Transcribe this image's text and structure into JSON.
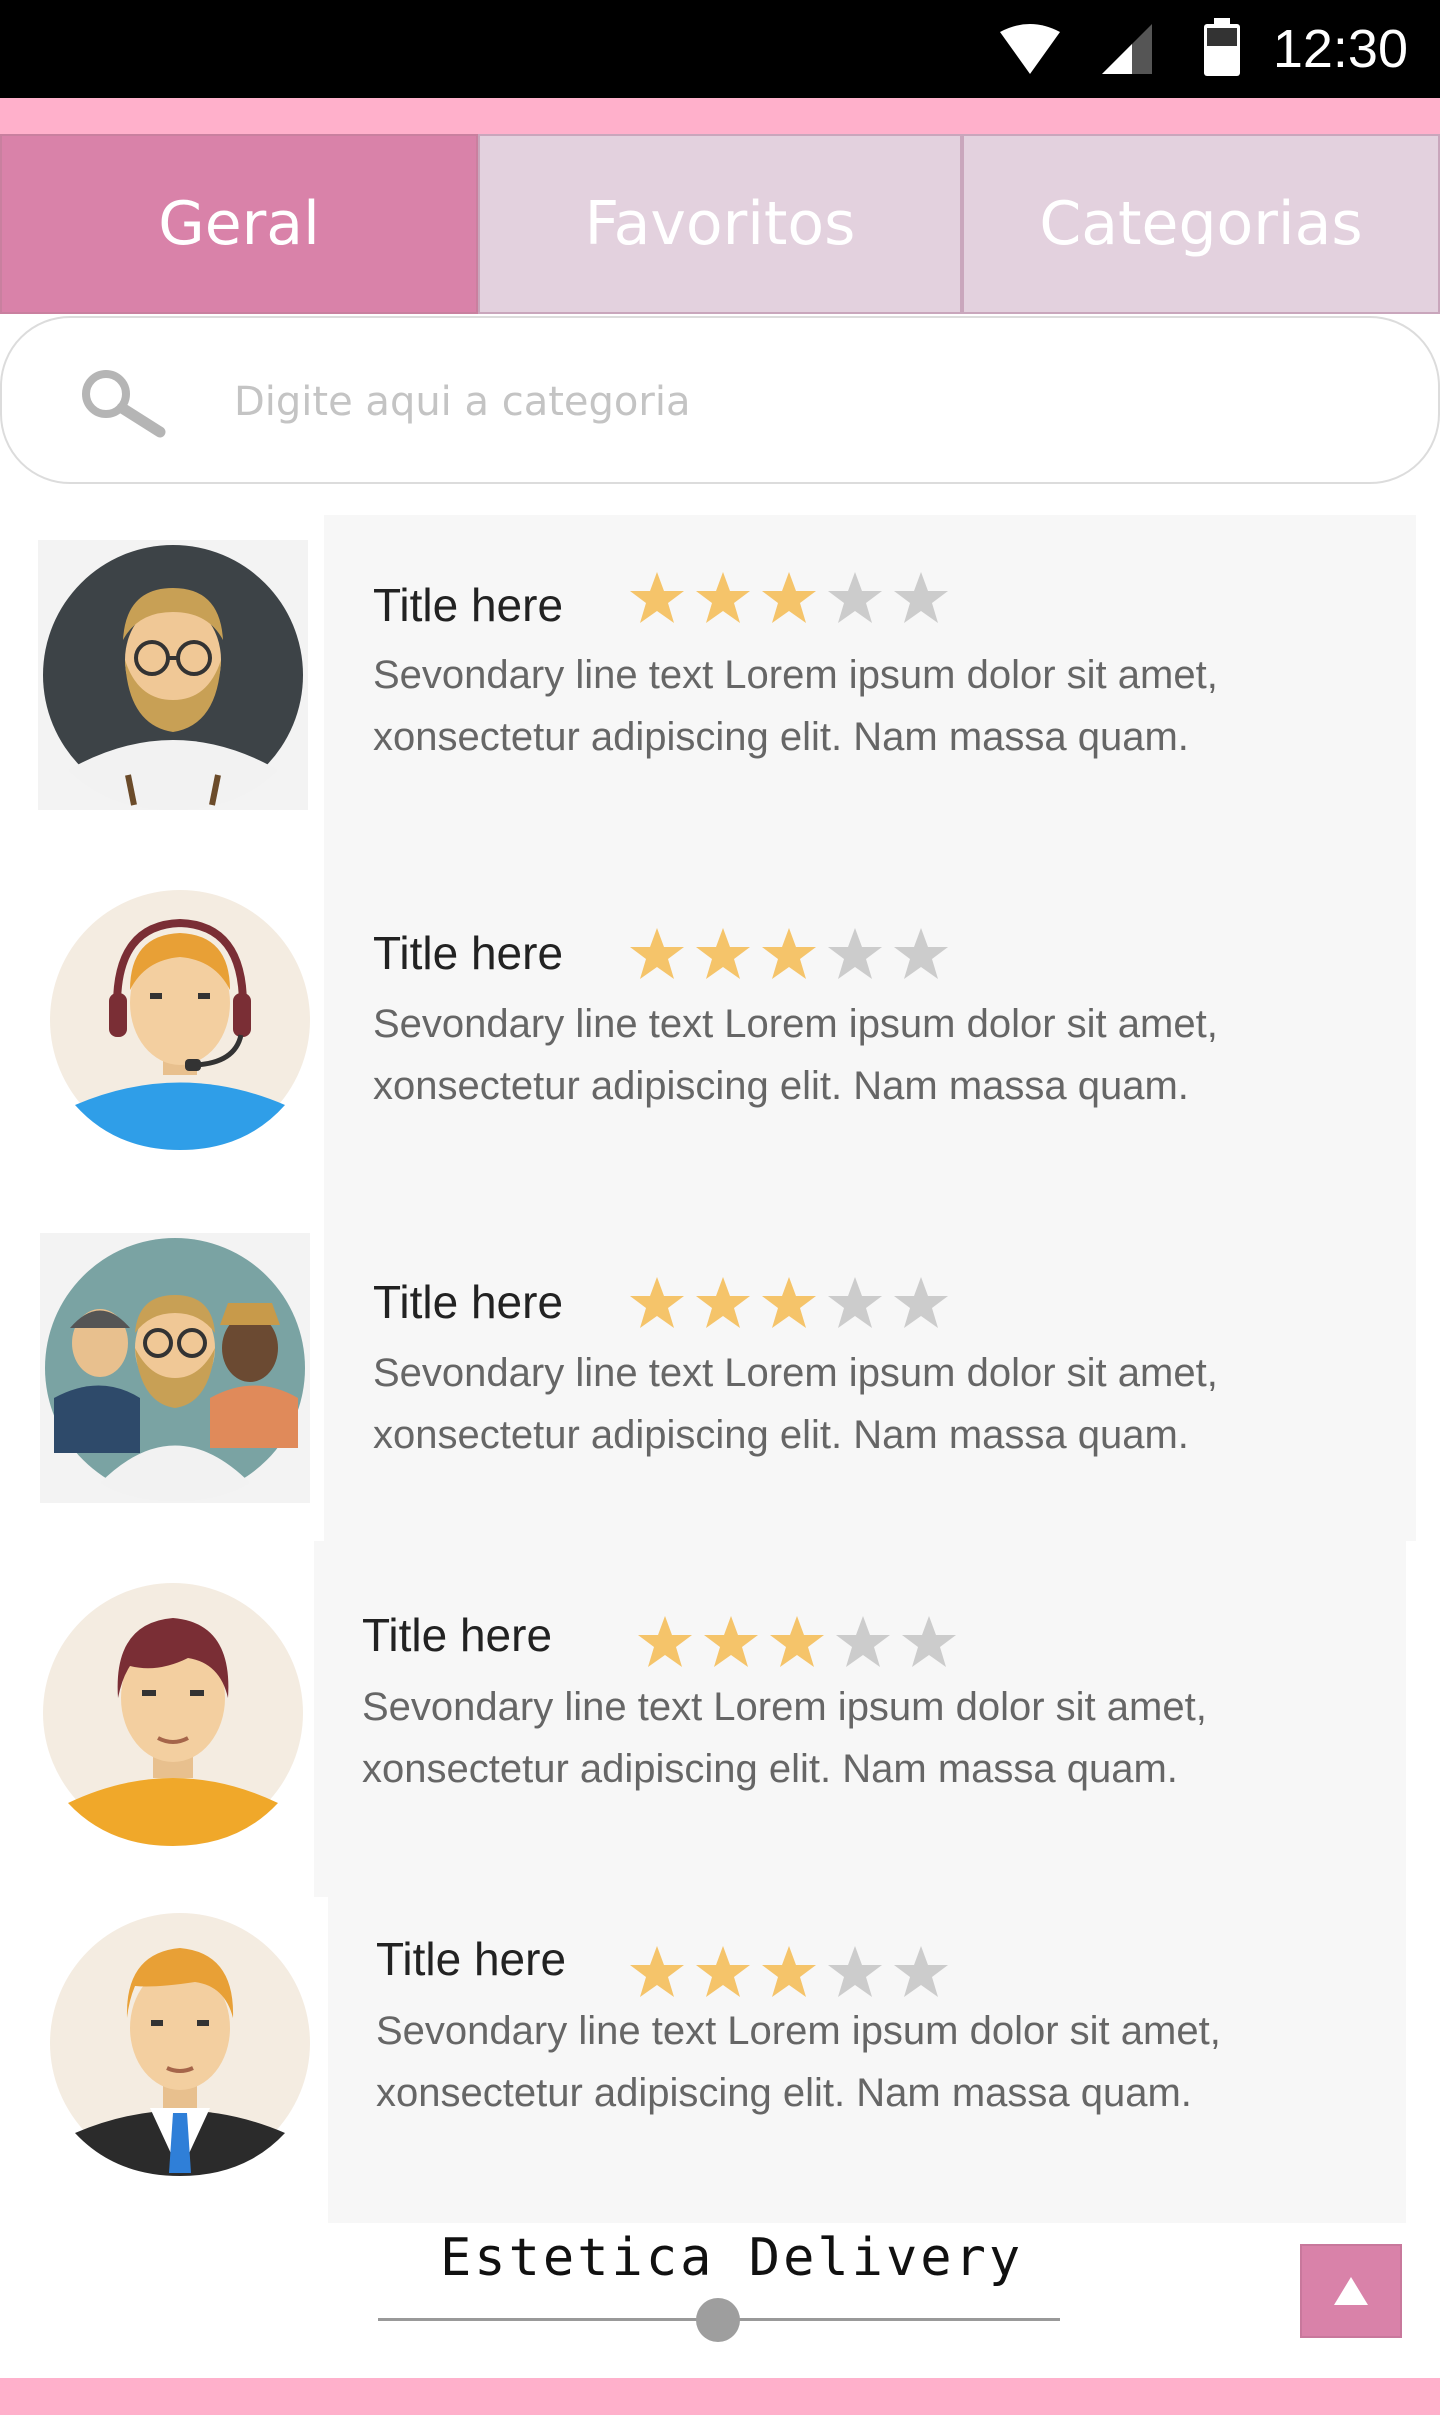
{
  "status_bar": {
    "time": "12:30",
    "icons": [
      "wifi-icon",
      "signal-icon",
      "battery-icon"
    ]
  },
  "tabs": [
    {
      "label": "Geral",
      "active": true
    },
    {
      "label": "Favoritos",
      "active": false
    },
    {
      "label": "Categorias",
      "active": false
    }
  ],
  "search": {
    "placeholder": "Digite aqui a categoria",
    "icon": "search-icon"
  },
  "list": [
    {
      "title": "Title here",
      "description": "Sevondary line text Lorem ipsum dolor sit amet, xonsectetur adipiscing elit. Nam massa quam.",
      "rating": 3,
      "max_rating": 5,
      "avatar": "bearded-man-glasses-avatar"
    },
    {
      "title": "Title here",
      "description": "Sevondary line text Lorem ipsum dolor sit amet, xonsectetur adipiscing elit. Nam massa quam.",
      "rating": 3,
      "max_rating": 5,
      "avatar": "headset-support-avatar"
    },
    {
      "title": "Title here",
      "description": "Sevondary line text Lorem ipsum dolor sit amet, xonsectetur adipiscing elit. Nam massa quam.",
      "rating": 3,
      "max_rating": 5,
      "avatar": "group-of-men-avatar"
    },
    {
      "title": "Title here",
      "description": "Sevondary line text Lorem ipsum dolor sit amet, xonsectetur adipiscing elit. Nam massa quam.",
      "rating": 3,
      "max_rating": 5,
      "avatar": "brown-hair-man-avatar"
    },
    {
      "title": "Title here",
      "description": "Sevondary line text Lorem ipsum dolor sit amet, xonsectetur adipiscing elit. Nam massa quam.",
      "rating": 3,
      "max_rating": 5,
      "avatar": "businessman-avatar"
    }
  ],
  "footer": {
    "title": "Estetica Delivery",
    "slider_value": 0.5,
    "scroll_top_icon": "arrow-up-icon"
  },
  "colors": {
    "accent": "#d982a9",
    "strip": "#ffb0cb",
    "tab_inactive": "#e3d1de",
    "star_on": "#f5c46a",
    "star_off": "#cccccc",
    "card_bg": "#f7f7f7"
  }
}
